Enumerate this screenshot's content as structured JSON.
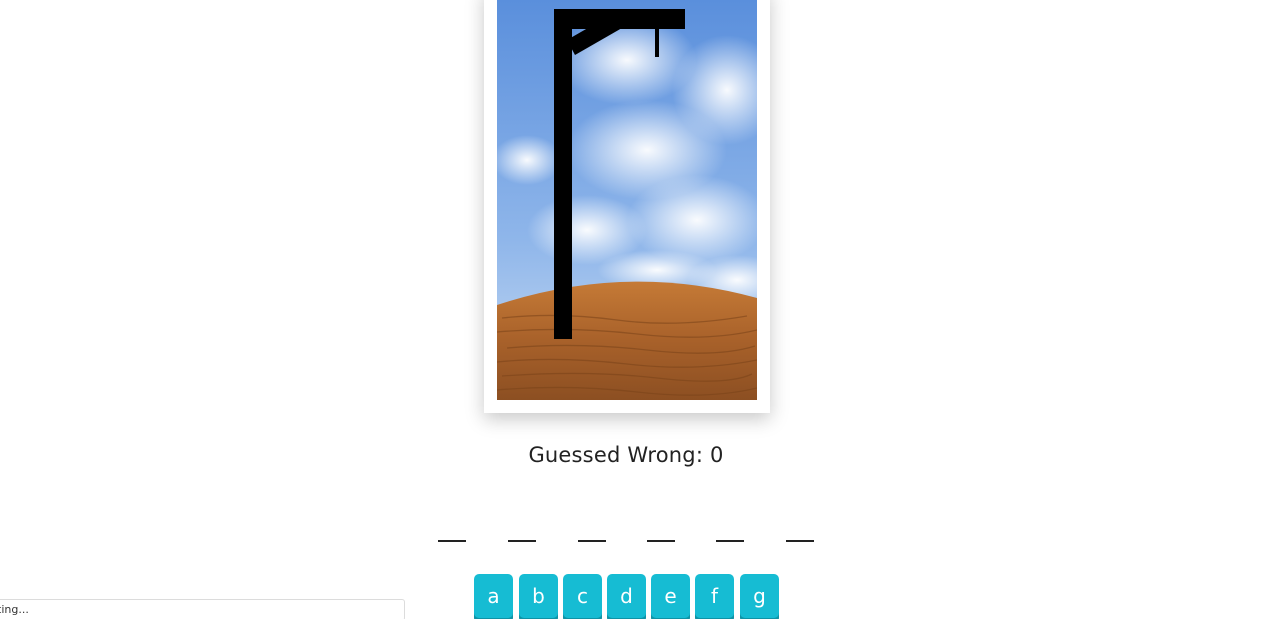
{
  "game": {
    "wrong_label": "Guessed Wrong: 0",
    "word_length": 6,
    "blanks": [
      "",
      "",
      "",
      "",
      "",
      ""
    ]
  },
  "keyboard": {
    "keys": [
      "a",
      "b",
      "c",
      "d",
      "e",
      "f",
      "g"
    ]
  },
  "status_bar": {
    "text": "ting..."
  },
  "colors": {
    "key_background": "#16bcd3",
    "key_shadow": "#0f93a6",
    "gallows": "#000000",
    "sky_top": "#5a8fdc",
    "ground": "#b86a2c"
  }
}
